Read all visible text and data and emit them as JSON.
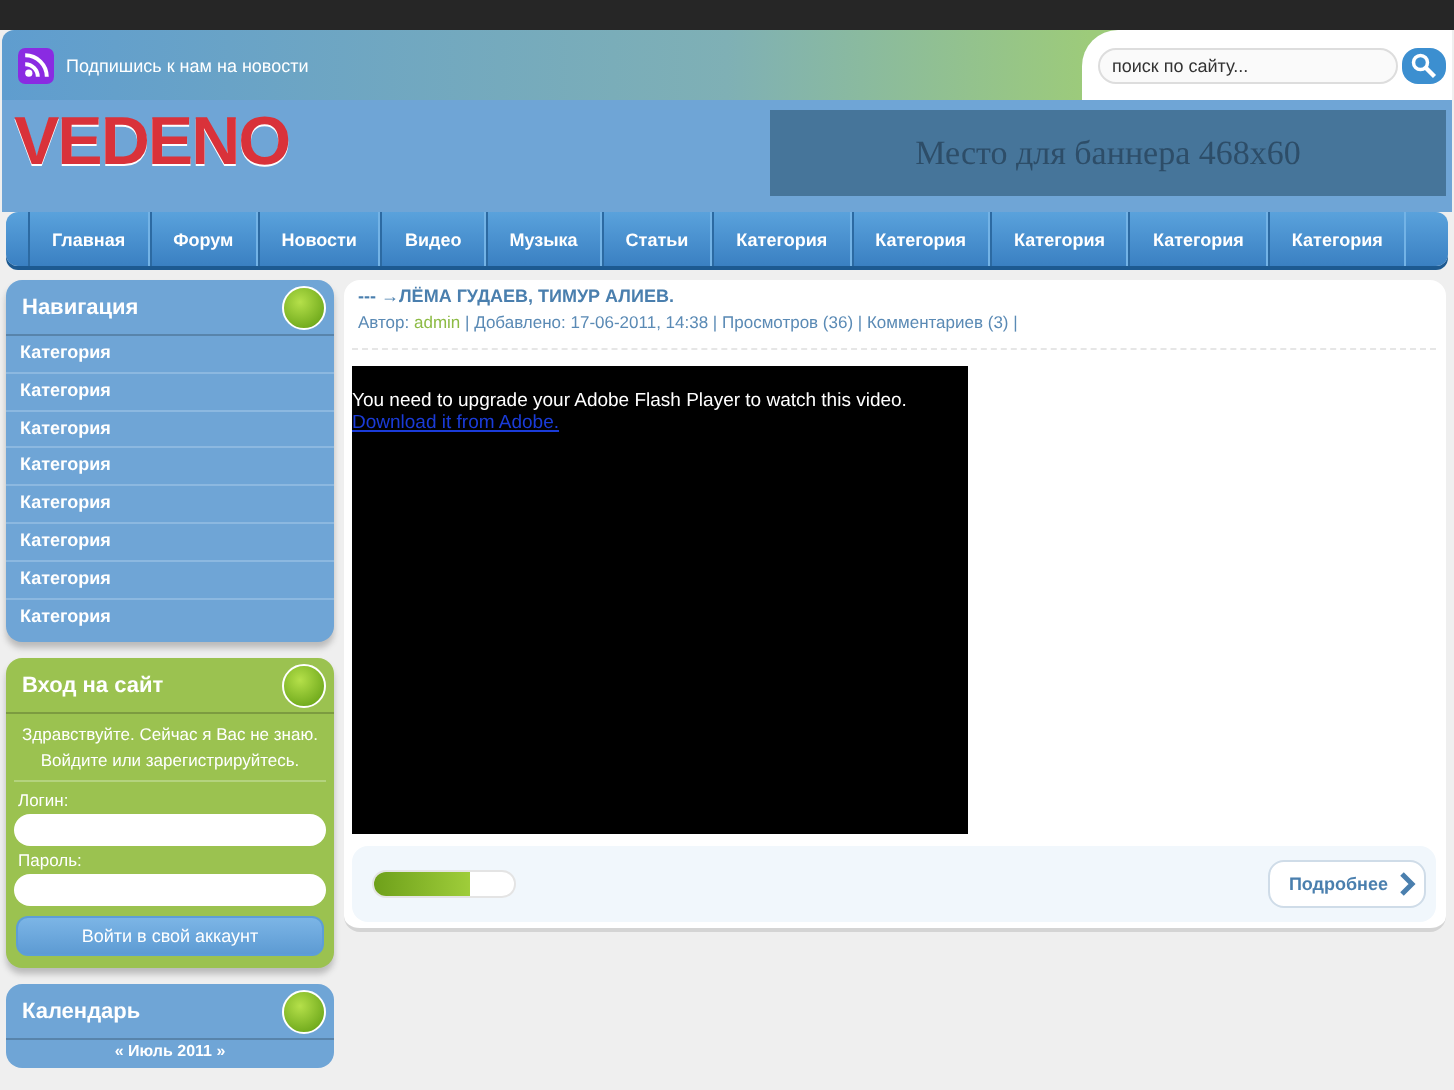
{
  "header": {
    "subscribe": "Подпишись к нам на новости",
    "search": {
      "placeholder": "поиск по сайту..."
    },
    "logo": "VEDENO",
    "banner": "Место для баннера 468x60"
  },
  "nav": [
    "Главная",
    "Форум",
    "Новости",
    "Видео",
    "Музыка",
    "Статьи",
    "Категория",
    "Категория",
    "Категория",
    "Категория",
    "Категория"
  ],
  "navigation_block": {
    "title": "Навигация",
    "items": [
      "Категория",
      "Категория",
      "Категория",
      "Категория",
      "Категория",
      "Категория",
      "Категория",
      "Категория"
    ]
  },
  "login_block": {
    "title": "Вход на сайт",
    "greeting": "Здравствуйте. Сейчас я Вас не знаю. Войдите или зарегистрируйтесь.",
    "login_label": "Логин:",
    "password_label": "Пароль:",
    "submit": "Войти в свой аккаунт"
  },
  "calendar_block": {
    "title": "Календарь",
    "month": "« Июль 2011 »"
  },
  "post": {
    "title": "--- →ЛЁМА ГУДАЕВ, ТИМУР АЛИЕВ.",
    "author_label": "Автор:",
    "author": "admin",
    "meta": "| Добавлено: 17-06-2011, 14:38 | Просмотров (36) | Комментариев (3) |",
    "flash_message": "You need to upgrade your Adobe Flash Player to watch this video.",
    "flash_link": "Download it from Adobe.",
    "rating": {
      "level": 0.68
    },
    "more": "Подробнее"
  }
}
